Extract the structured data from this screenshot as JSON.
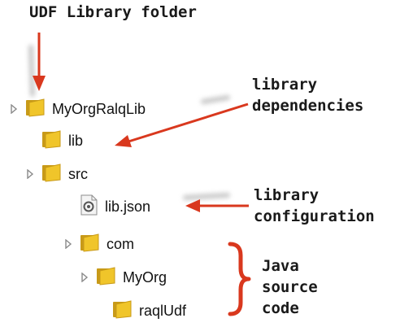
{
  "annotations": {
    "root": "UDF Library folder",
    "deps": "library\ndependencies",
    "config": "library\nconfiguration",
    "java": "Java\nsource\ncode"
  },
  "tree": {
    "root": "MyOrgRalqLib",
    "lib": "lib",
    "src": "src",
    "libjson": "lib.json",
    "com": "com",
    "myorg": "MyOrg",
    "raqludf": "raqlUdf"
  },
  "colors": {
    "arrow": "#d9381e",
    "folder": "#f0c52a",
    "folder_dark": "#c89a18",
    "toggle": "#8a8a8a"
  }
}
